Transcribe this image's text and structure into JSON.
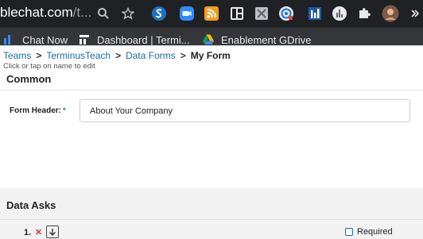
{
  "browser": {
    "url_main": "blechat.com",
    "url_dim": "/t..."
  },
  "bookmarks": [
    {
      "label": "Chat Now"
    },
    {
      "label": "Dashboard | Termi..."
    },
    {
      "label": "Enablement GDrive"
    }
  ],
  "breadcrumb": {
    "items": [
      "Teams",
      "TerminusTeach",
      "Data Forms"
    ],
    "separator": ">",
    "current": "My Form",
    "hint": "Click or tap on name to edit"
  },
  "common": {
    "title": "Common",
    "form_header_label": "Form Header:",
    "required_marker": "*",
    "form_header_value": "About Your Company"
  },
  "data_asks": {
    "title": "Data Asks",
    "items": [
      {
        "number": "1.",
        "remove_symbol": "✕",
        "required_label": "Required"
      }
    ]
  },
  "colors": {
    "link": "#1a6aa8",
    "chrome_dark": "#202124",
    "bookmark_bar": "#35363a"
  }
}
